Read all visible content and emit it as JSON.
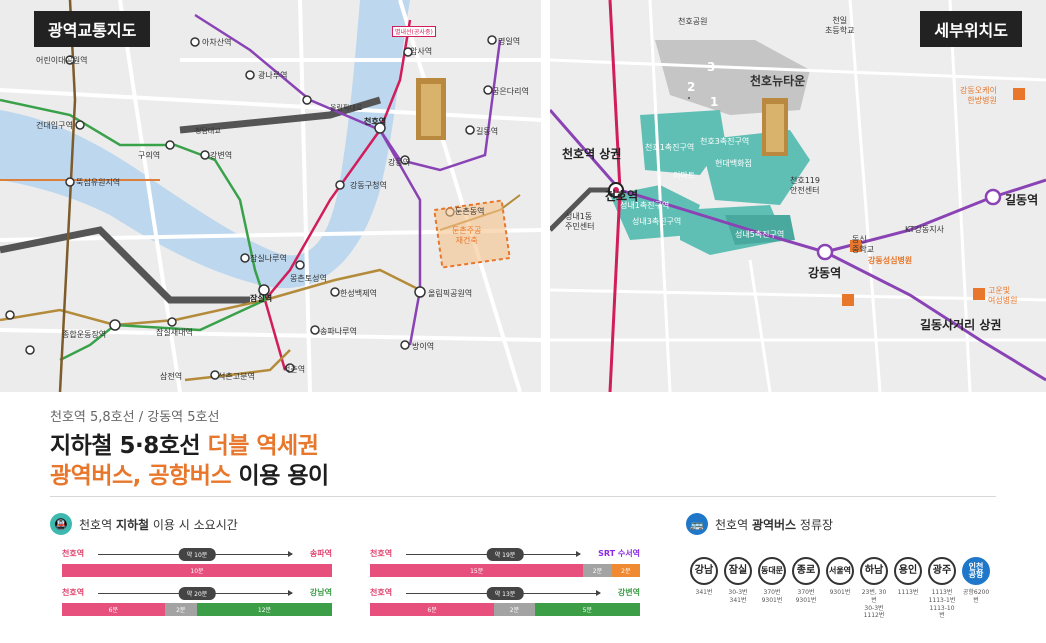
{
  "maps": {
    "left": {
      "badge": "광역교통지도",
      "labels": {
        "achasan": "아차산역",
        "gwangnaru": "광나루역",
        "cheonho": "천호역",
        "gangdong": "강동역",
        "amsa": "암사역",
        "myeongil": "명일역",
        "gubeundari": "굽은다리역",
        "gildong": "길동역",
        "dunchon": "둔촌동역",
        "olympic": "올림픽공원역",
        "banghwa": "방이역",
        "jamsilnaru": "잠실나루역",
        "jamsil": "잠실역",
        "seokchon": "석촌역",
        "songpanaru": "송파나루역",
        "hansung": "한성백제역",
        "mongchon": "몽촌토성역",
        "gangdonggu": "강동구청역",
        "guui": "구의역",
        "gangbyeon": "강변역",
        "konkuk": "건대입구역",
        "sports": "종합운동장역",
        "jamsilsaenae": "잠실새내역",
        "samjeon": "삼전역",
        "seokchongobun": "석촌고분역",
        "childrens": "어린이대공원역",
        "ttukseom": "뚝섬유원지역",
        "cheongdam": "청담대교",
        "olympicdaero": "올림픽대로",
        "dunchonsite": "둔촌주공\n재건축",
        "byeollae": "별내선(공사중)"
      }
    },
    "right": {
      "badge": "세부위치도",
      "labels": {
        "cheonhoArea": "천호역 상권",
        "cheonho": "천호역",
        "gangdong": "강동역",
        "gildong": "길동역",
        "gildongSageori": "길동사거리 상권",
        "newtown": "천호뉴타운",
        "zone1": "천호1촉진구역",
        "zone3": "천호3촉진구역",
        "seongnae3": "성내3촉진구역",
        "seongnae5": "성내5촉진구역",
        "seongnae1": "성내1촉진구역",
        "hospital1": "강동성심병원",
        "hospital2": "강동오케이\n한방병원",
        "hospital3": "고운빛\n여성병원",
        "fire": "천호119\n안전센터",
        "school": "천일\n초등학교",
        "park": "천호공원",
        "kt": "KT강동지사",
        "gangdongmiddle": "동신\n중학교",
        "hyundai": "현대백화점",
        "emart": "이마트",
        "community": "성내1동\n주민센터",
        "nums": [
          "1",
          "2",
          "3"
        ]
      }
    }
  },
  "text": {
    "subtitle": "천호역 5,8호선 / 강동역 5호선",
    "line1_part1": "지하철 5·8호선 ",
    "line1_part2": "더블 역세권",
    "line2_part1": "광역버스, 공항버스",
    "line2_part2": " 이용 용이"
  },
  "subway_section": {
    "title_prefix": "천호역 ",
    "title_bold": "지하철",
    "title_suffix": " 이용 시 소요시간",
    "icon": "subway-icon"
  },
  "bus_section": {
    "title_prefix": "천호역 ",
    "title_bold": "광역버스",
    "title_suffix": " 정류장",
    "icon": "bus-icon"
  },
  "timebars": [
    {
      "from": "천호역",
      "to": "송파역",
      "total": "약 10분",
      "segments": [
        {
          "label": "10분",
          "color": "pink",
          "share": 1.0
        }
      ],
      "to_color": "pink"
    },
    {
      "from": "천호역",
      "to": "SRT 수서역",
      "total": "약 19분",
      "segments": [
        {
          "label": "15분",
          "color": "pink",
          "share": 0.79
        },
        {
          "label": "2분",
          "color": "grey",
          "share": 0.105
        },
        {
          "label": "2분",
          "color": "orange-seg",
          "share": 0.105
        }
      ],
      "to_color": "purple"
    },
    {
      "from": "천호역",
      "to": "강남역",
      "total": "약 20분",
      "segments": [
        {
          "label": "6분",
          "color": "pink",
          "share": 0.38
        },
        {
          "label": "2분",
          "color": "grey",
          "share": 0.12
        },
        {
          "label": "12분",
          "color": "green",
          "share": 0.5
        }
      ],
      "to_color": "green"
    },
    {
      "from": "천호역",
      "to": "강변역",
      "total": "약 13분",
      "segments": [
        {
          "label": "6분",
          "color": "pink",
          "share": 0.46
        },
        {
          "label": "2분",
          "color": "grey",
          "share": 0.15
        },
        {
          "label": "5분",
          "color": "green",
          "share": 0.39
        }
      ],
      "to_color": "green"
    }
  ],
  "buses": [
    {
      "name": "강남",
      "routes": "341번"
    },
    {
      "name": "잠실",
      "routes": "30-3번\n341번"
    },
    {
      "name": "동대문",
      "routes": "370번\n9301번"
    },
    {
      "name": "종로",
      "routes": "370번\n9301번"
    },
    {
      "name": "서울역",
      "routes": "9301번"
    },
    {
      "name": "하남",
      "routes": "23번, 30번\n30-3번\n1112번"
    },
    {
      "name": "용인",
      "routes": "1113번"
    },
    {
      "name": "광주",
      "routes": "1113번\n1113-1번\n1113-10번"
    },
    {
      "name": "인천\n공항",
      "routes": "공항6200번",
      "highlight": true
    }
  ]
}
